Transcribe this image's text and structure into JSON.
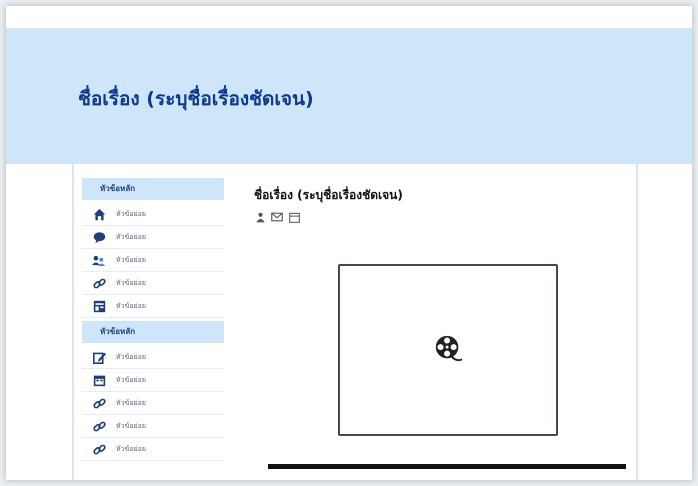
{
  "page": {
    "banner_title": "ชื่อเรื่อง (ระบุชื่อเรื่องชัดเจน)",
    "main_title": "ชื่อเรื่อง (ระบุชื่อเรื่องชัดเจน)"
  },
  "sidebar": {
    "section1": {
      "header": "หัวข้อหลัก",
      "items": [
        {
          "label": "หัวข้อย่อย",
          "icon": "home-icon"
        },
        {
          "label": "หัวข้อย่อย",
          "icon": "chat-icon"
        },
        {
          "label": "หัวข้อย่อย",
          "icon": "users-icon"
        },
        {
          "label": "หัวข้อย่อย",
          "icon": "link-icon"
        },
        {
          "label": "หัวข้อย่อย",
          "icon": "document-icon"
        }
      ]
    },
    "section2": {
      "header": "หัวข้อหลัก",
      "items": [
        {
          "label": "หัวข้อย่อย",
          "icon": "edit-icon"
        },
        {
          "label": "หัวข้อย่อย",
          "icon": "calendar-icon"
        },
        {
          "label": "หัวข้อย่อย",
          "icon": "link-icon"
        },
        {
          "label": "หัวข้อย่อย",
          "icon": "link-icon"
        },
        {
          "label": "หัวข้อย่อย",
          "icon": "link-icon"
        }
      ]
    }
  },
  "meta_icons": [
    "person-icon",
    "mail-icon",
    "calendar-icon"
  ],
  "video": {
    "icon": "film-reel-icon"
  },
  "colors": {
    "banner_bg": "#cfe5fa",
    "title_blue": "#0d3a8e",
    "sidebar_header_bg": "#cfe5fa"
  }
}
